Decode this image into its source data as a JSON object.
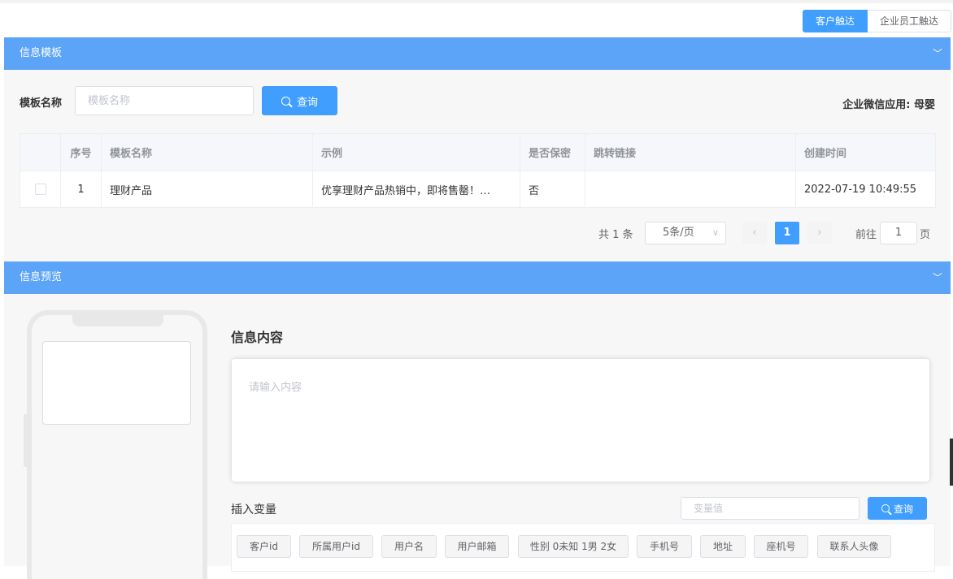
{
  "mode_toggle": {
    "customer": "客户触达",
    "employee": "企业员工触达"
  },
  "template_panel": {
    "title": "信息模板",
    "search_label": "模板名称",
    "search_placeholder": "模板名称",
    "search_button": "查询",
    "app_info": "企业微信应用: 母婴",
    "table": {
      "headers": [
        "序号",
        "模板名称",
        "示例",
        "是否保密",
        "跳转链接",
        "创建时间"
      ],
      "rows": [
        {
          "index": "1",
          "name": "理财产品",
          "example": "优享理财产品热销中，即将售罄！…",
          "secret": "否",
          "link": "",
          "created": "2022-07-19 10:49:55"
        }
      ]
    },
    "pagination": {
      "total": "共 1 条",
      "page_size": "5条/页",
      "prev": "‹",
      "current": "1",
      "next": "›",
      "goto_prefix": "前往",
      "goto_value": "1",
      "goto_suffix": "页"
    }
  },
  "preview_panel": {
    "title": "信息预览",
    "content_title": "信息内容",
    "content_placeholder": "请输入内容",
    "variable_label": "插入变量",
    "variable_placeholder": "变量值",
    "variable_search": "查询",
    "variables": [
      "客户id",
      "所属用户id",
      "用户名",
      "用户邮箱",
      "性别 0未知 1男 2女",
      "手机号",
      "地址",
      "座机号",
      "联系人头像"
    ]
  },
  "colors": {
    "accent": "#409eff",
    "header_bar": "#5ba4f7",
    "panel_bg": "#f7f7f7"
  }
}
